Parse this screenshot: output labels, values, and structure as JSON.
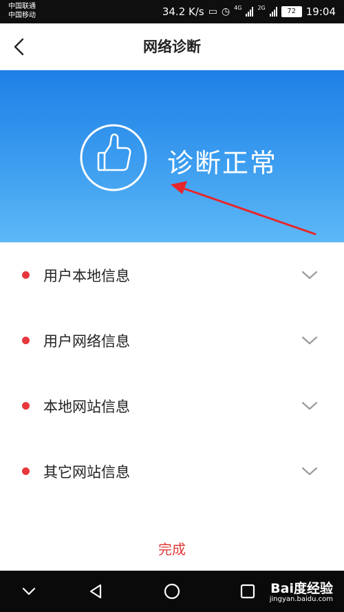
{
  "status_bar": {
    "carrier_1": "中国联通",
    "carrier_2": "中国移动",
    "net_speed": "34.2 K/s",
    "net_tag_1": "4G",
    "net_tag_2": "2G",
    "battery": "72",
    "time": "19:04"
  },
  "header": {
    "title": "网络诊断",
    "back_icon": "chevron-left-icon"
  },
  "banner": {
    "status_text": "诊断正常",
    "icon": "thumbs-up-icon",
    "annotation": "red-arrow"
  },
  "items": [
    {
      "label": "用户本地信息"
    },
    {
      "label": "用户网络信息"
    },
    {
      "label": "本地网站信息"
    },
    {
      "label": "其它网站信息"
    }
  ],
  "footer": {
    "done_label": "完成"
  },
  "system_nav": {
    "watermark_logo": "Bai度经验",
    "watermark_url": "jingyan.baidu.com"
  },
  "colors": {
    "accent_red": "#e23a3a",
    "dot_red": "#e8373c",
    "banner_top": "#1e7fe6",
    "banner_bottom": "#5db8f6"
  }
}
